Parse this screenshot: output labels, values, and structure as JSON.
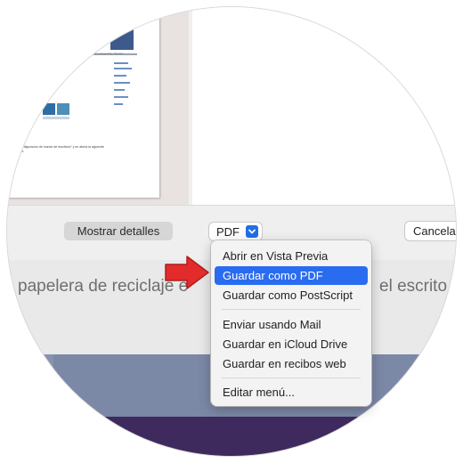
{
  "dialog": {
    "details_button": "Mostrar detalles",
    "pdf_button": "PDF",
    "cancel_button": "Cancela"
  },
  "pdf_menu": {
    "items": [
      {
        "label": "Abrir en Vista Previa"
      },
      {
        "label": "Guardar como PDF",
        "selected": true
      },
      {
        "label": "Guardar como PostScript"
      },
      {
        "label": "Enviar usando Mail"
      },
      {
        "label": "Guardar en iCloud Drive"
      },
      {
        "label": "Guardar en recibos web"
      },
      {
        "label": "Editar menú..."
      }
    ]
  },
  "background": {
    "text_left": "papelera de reciclaje e",
    "text_right": "el escrito"
  },
  "thumbnail": {
    "line1": "fhes a la sección \"Temas\":",
    "line2": "\"Configuración de mundo de escritorio\" y en abrirá la siguiente",
    "line3": "rida:"
  },
  "colors": {
    "accent": "#2a6cf0",
    "arrow": "#e32b2b"
  }
}
